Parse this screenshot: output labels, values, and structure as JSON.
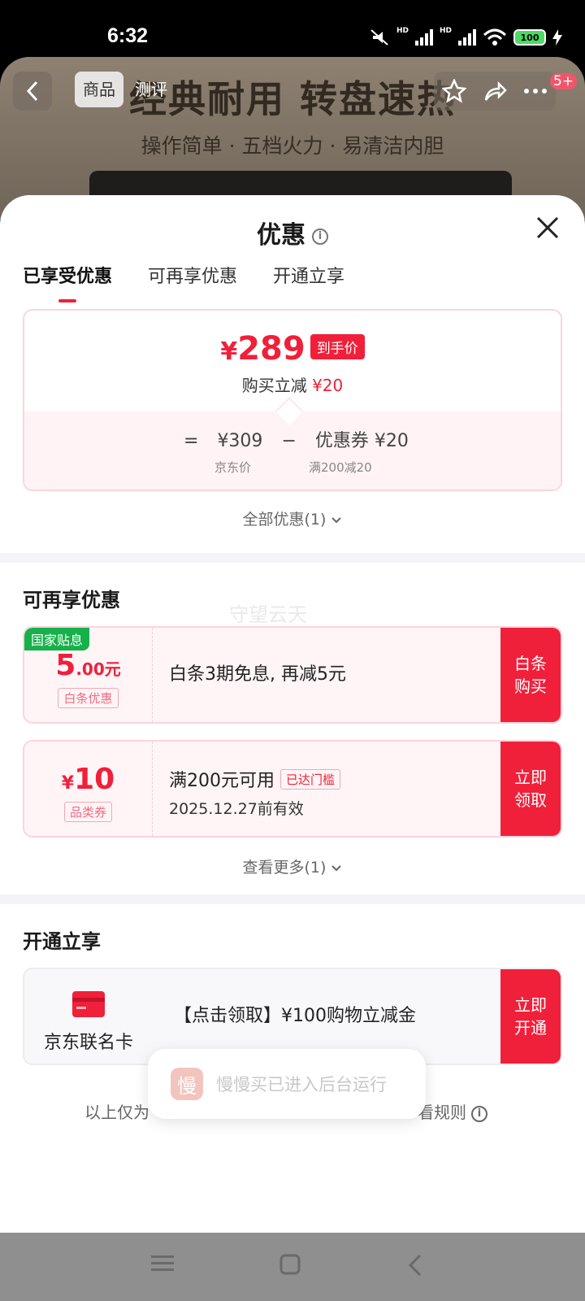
{
  "status_bar": {
    "time": "6:32",
    "signal_hd_1": "HD",
    "signal_hd_2": "HD",
    "battery": "100"
  },
  "product_header": {
    "banner_title": "经典耐用 转盘速热",
    "banner_subtitle": "操作简单 · 五档火力 · 易清洁内胆",
    "tabs": [
      "商品",
      "测评"
    ],
    "notification_count": "5+"
  },
  "sheet": {
    "title": "优惠",
    "tabs": [
      "已享受优惠",
      "可再享优惠",
      "开通立享"
    ],
    "active_tab": 0
  },
  "price_card": {
    "currency": "¥",
    "final_price": "289",
    "final_tag": "到手价",
    "discount_label": "购买立减",
    "discount_amount": "¥20",
    "equals": "=",
    "jd_price": "¥309",
    "minus": "−",
    "coupon_label": "优惠券",
    "coupon_amount": "¥20",
    "jd_price_label": "京东价",
    "coupon_rule": "满200减20"
  },
  "all_promotions": "全部优惠(1)",
  "more_section": {
    "title": "可再享优惠",
    "watermark": "守望云天",
    "coupons": [
      {
        "corner_tag": "国家贴息",
        "amount_int": "5",
        "amount_dec": ".00",
        "amount_unit": "元",
        "type_tag": "白条优惠",
        "description": "白条3期免息, 再减5元",
        "button": [
          "白条",
          "购买"
        ]
      },
      {
        "currency": "¥",
        "amount": "10",
        "type_tag": "品类券",
        "condition": "满200元可用",
        "status_tag": "已达门槛",
        "validity": "2025.12.27前有效",
        "button": [
          "立即",
          "领取"
        ]
      }
    ],
    "view_more": "查看更多(1)"
  },
  "open_section": {
    "title": "开通立享",
    "card_name": "京东联名卡",
    "offer": "【点击领取】¥100购物立减金",
    "button": [
      "立即",
      "开通"
    ]
  },
  "toast": {
    "icon_char": "慢",
    "text": "慢慢买已进入后台运行"
  },
  "disclaimer": {
    "left": "以上仅为",
    "right": "看规则"
  },
  "colors": {
    "accent_red": "#f0203a",
    "green_tag": "#16b14a"
  }
}
